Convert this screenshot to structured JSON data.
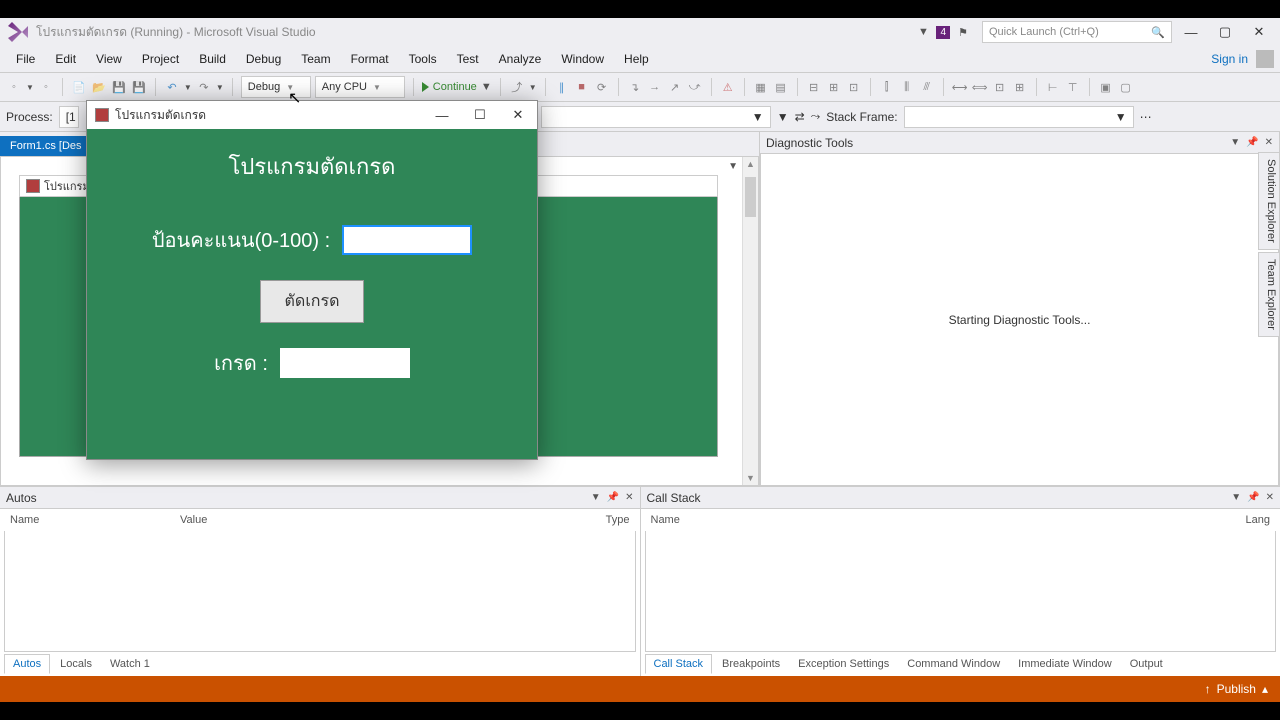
{
  "window": {
    "title": "โปรแกรมตัดเกรด (Running) - Microsoft Visual Studio",
    "notification_badge": "4",
    "quick_launch_placeholder": "Quick Launch (Ctrl+Q)",
    "sign_in": "Sign in"
  },
  "menu": {
    "items": [
      "File",
      "Edit",
      "View",
      "Project",
      "Build",
      "Debug",
      "Team",
      "Format",
      "Tools",
      "Test",
      "Analyze",
      "Window",
      "Help"
    ]
  },
  "toolbar": {
    "config": "Debug",
    "platform": "Any CPU",
    "continue": "Continue"
  },
  "debugbar": {
    "process_label": "Process:",
    "process_value": "[1",
    "stack_frame_label": "Stack Frame:"
  },
  "document": {
    "tab": "Form1.cs [Des",
    "designer_title_prefix": "โปรแกรม"
  },
  "diagnostic": {
    "title": "Diagnostic Tools",
    "status": "Starting Diagnostic Tools..."
  },
  "side_tabs": [
    "Solution Explorer",
    "Team Explorer"
  ],
  "autos": {
    "title": "Autos",
    "cols": {
      "name": "Name",
      "value": "Value",
      "type": "Type"
    },
    "tabs": [
      "Autos",
      "Locals",
      "Watch 1"
    ]
  },
  "callstack": {
    "title": "Call Stack",
    "cols": {
      "name": "Name",
      "lang": "Lang"
    },
    "tabs": [
      "Call Stack",
      "Breakpoints",
      "Exception Settings",
      "Command Window",
      "Immediate Window",
      "Output"
    ]
  },
  "statusbar": {
    "publish": "Publish"
  },
  "app": {
    "title": "โปรแกรมตัดเกรด",
    "heading": "โปรแกรมตัดเกรด",
    "score_label": "ป้อนคะแนน(0-100) :",
    "score_value": "",
    "button": "ตัดเกรด",
    "grade_label": "เกรด :",
    "grade_value": ""
  }
}
